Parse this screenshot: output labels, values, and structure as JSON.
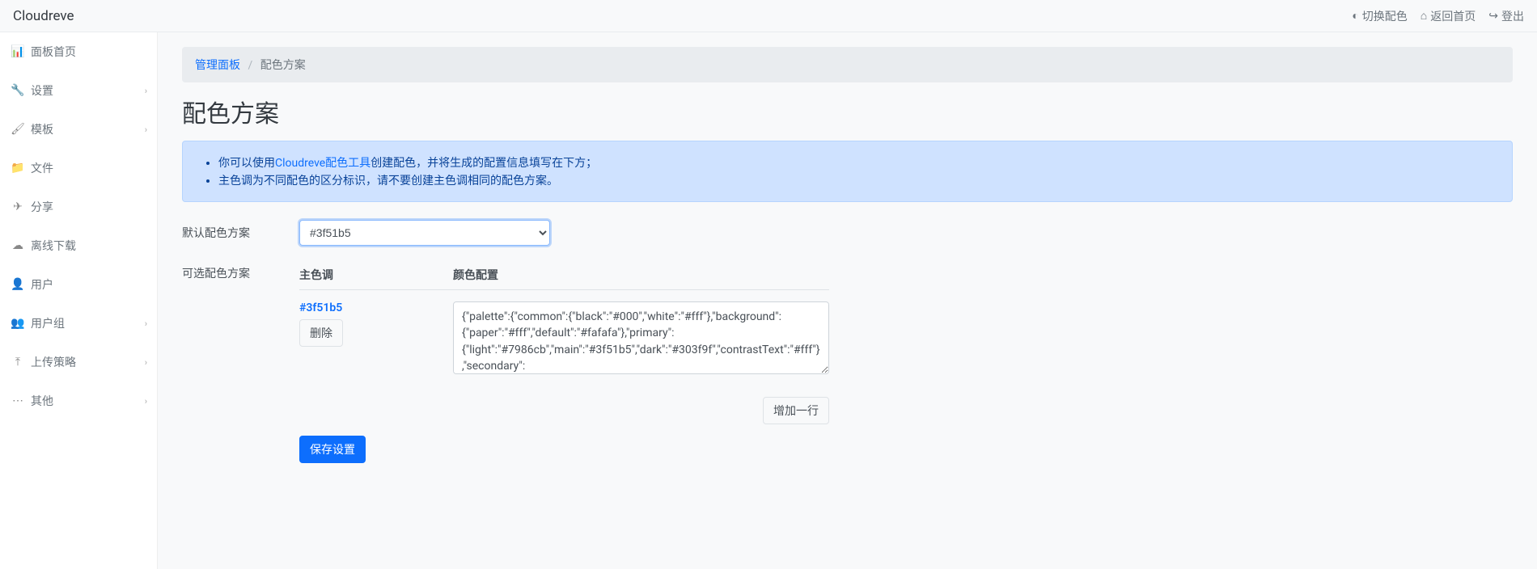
{
  "brand": "Cloudreve",
  "topbar": {
    "toggle_theme": "切换配色",
    "back_home": "返回首页",
    "logout": "登出"
  },
  "sidebar": [
    {
      "icon": "dashboard",
      "label": "面板首页",
      "expandable": false
    },
    {
      "icon": "wrench",
      "label": "设置",
      "expandable": true
    },
    {
      "icon": "brush",
      "label": "模板",
      "expandable": true
    },
    {
      "icon": "folder",
      "label": "文件",
      "expandable": false
    },
    {
      "icon": "send",
      "label": "分享",
      "expandable": false
    },
    {
      "icon": "cloud-down",
      "label": "离线下载",
      "expandable": false
    },
    {
      "icon": "user",
      "label": "用户",
      "expandable": false
    },
    {
      "icon": "users",
      "label": "用户组",
      "expandable": true
    },
    {
      "icon": "upload",
      "label": "上传策略",
      "expandable": true
    },
    {
      "icon": "dots",
      "label": "其他",
      "expandable": true
    }
  ],
  "breadcrumb": {
    "parent": "管理面板",
    "current": "配色方案"
  },
  "page_title": "配色方案",
  "alert": {
    "line1_pre": "你可以使用",
    "line1_link": "Cloudreve配色工具",
    "line1_post": "创建配色，并将生成的配置信息填写在下方；",
    "line2": "主色调为不同配色的区分标识，请不要创建主色调相同的配色方案。"
  },
  "form": {
    "default_scheme_label": "默认配色方案",
    "default_scheme_value": "#3f51b5",
    "default_scheme_options": [
      "#3f51b5"
    ],
    "optional_scheme_label": "可选配色方案",
    "col_main": "主色调",
    "col_config": "颜色配置",
    "rows": [
      {
        "main_color": "#3f51b5",
        "delete_label": "删除",
        "config": "{\"palette\":{\"common\":{\"black\":\"#000\",\"white\":\"#fff\"},\"background\":{\"paper\":\"#fff\",\"default\":\"#fafafa\"},\"primary\":{\"light\":\"#7986cb\",\"main\":\"#3f51b5\",\"dark\":\"#303f9f\",\"contrastText\":\"#fff\"},\"secondary\":"
      }
    ],
    "add_row_label": "增加一行",
    "save_label": "保存设置"
  }
}
